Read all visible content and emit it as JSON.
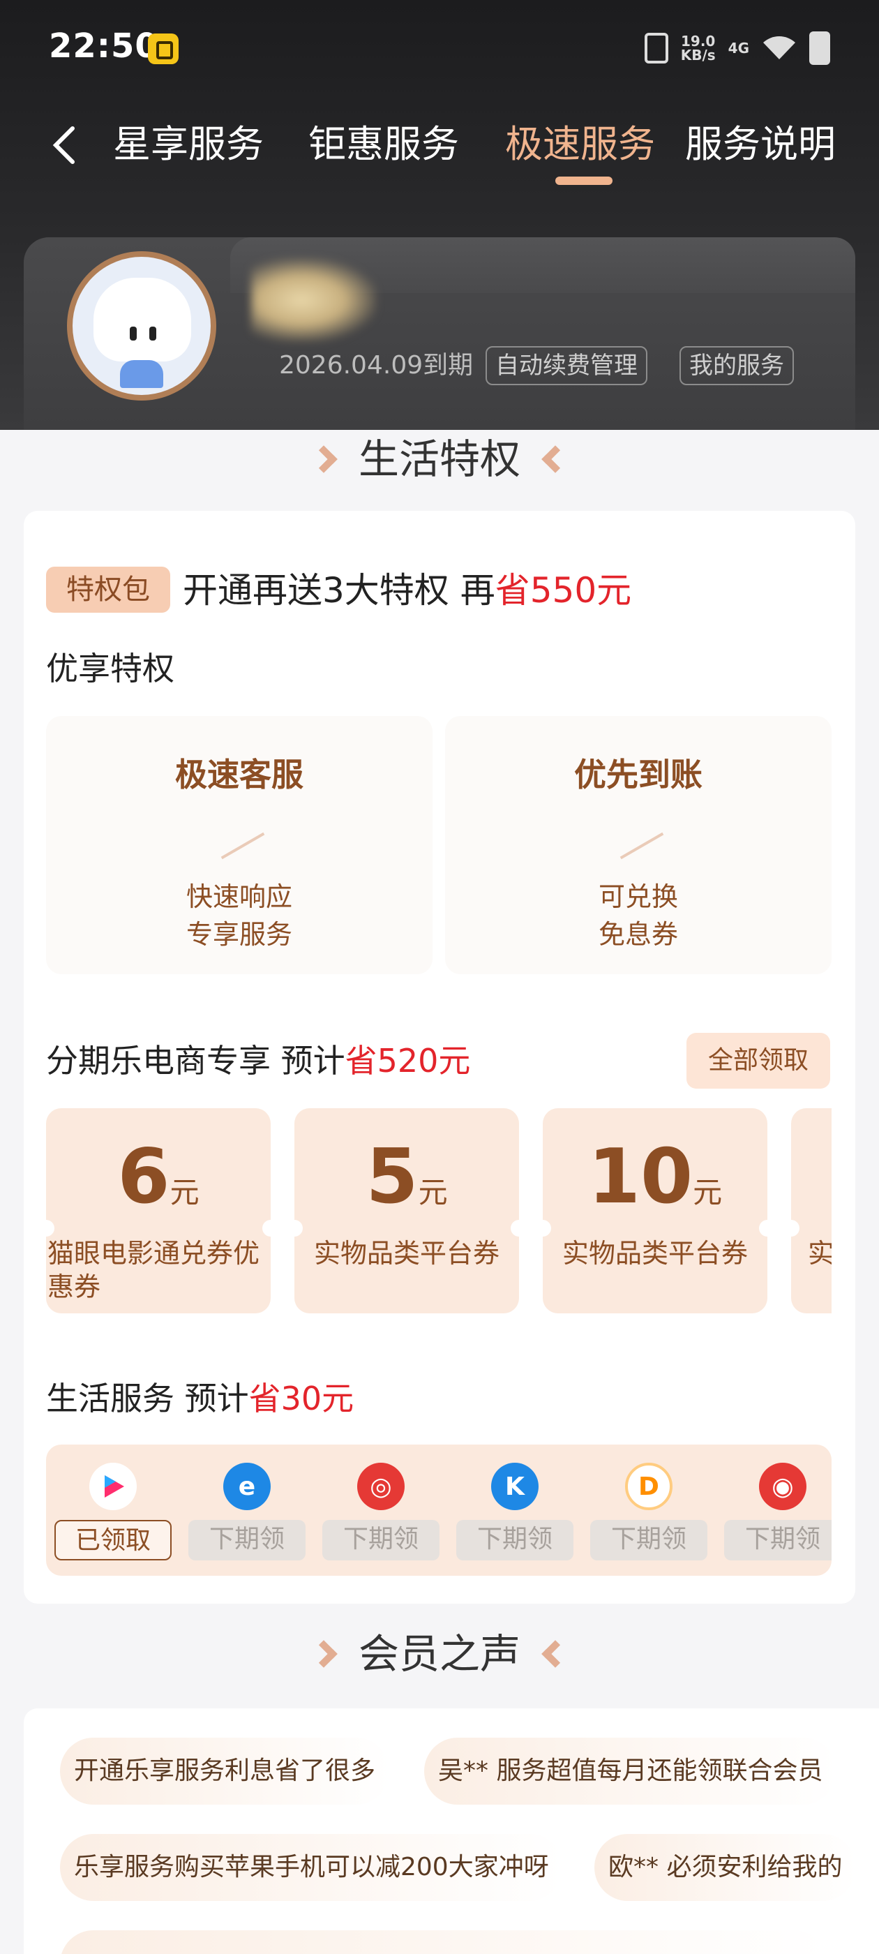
{
  "status_bar": {
    "time": "22:50",
    "net_speed_value": "19.0",
    "net_speed_unit": "KB/s",
    "network": "4G"
  },
  "nav": {
    "tabs": [
      {
        "label": "星享服务"
      },
      {
        "label": "钜惠服务"
      },
      {
        "label": "极速服务"
      },
      {
        "label": "服务说明"
      }
    ],
    "active_tab": "极速服务"
  },
  "member": {
    "expire_date": "2026.04.09到期",
    "auto_renew_label": "自动续费管理",
    "my_service_label": "我的服务"
  },
  "sections": {
    "life_privilege": "生活特权",
    "member_voice": "会员之声"
  },
  "privilege_pack": {
    "badge": "特权包",
    "headline_pre": "开通再送3大特权 再",
    "headline_save": "省550元"
  },
  "premium": {
    "title": "优享特权",
    "items": [
      {
        "name": "极速客服",
        "line1": "快速响应",
        "line2": "专享服务"
      },
      {
        "name": "优先到账",
        "line1": "可兑换",
        "line2": "免息券"
      }
    ]
  },
  "ecommerce": {
    "title_pre": "分期乐电商专享 预计",
    "title_save": "省520元",
    "collect_all": "全部领取",
    "coupons": [
      {
        "amount": "6",
        "unit": "元",
        "desc": "猫眼电影通兑券优惠券"
      },
      {
        "amount": "5",
        "unit": "元",
        "desc": "实物品类平台券"
      },
      {
        "amount": "10",
        "unit": "元",
        "desc": "实物品类平台券"
      },
      {
        "amount": "",
        "unit": "",
        "desc": "实"
      }
    ]
  },
  "life_service": {
    "title_pre": "生活服务 预计",
    "title_save": "省30元",
    "items": [
      {
        "icon": "video-app-icon",
        "button": "已领取",
        "color": "#ff2d6e"
      },
      {
        "icon": "e-app-icon",
        "button": "下期领",
        "color": "#1e88e5"
      },
      {
        "icon": "music-app-icon",
        "button": "下期领",
        "color": "#e53935"
      },
      {
        "icon": "k-app-icon",
        "button": "下期领",
        "color": "#1e88e5"
      },
      {
        "icon": "ride-app-icon",
        "button": "下期领",
        "color": "#ff8f00"
      },
      {
        "icon": "cat-app-icon",
        "button": "下期领",
        "color": "#e53935"
      }
    ]
  },
  "voices": [
    {
      "text": "开通乐享服务利息省了很多"
    },
    {
      "text": "吴**  服务超值每月还能领联合会员"
    },
    {
      "text": "乐享服务购买苹果手机可以减200大家冲呀"
    },
    {
      "text": "欧**  必须安利给我的"
    }
  ],
  "colors": {
    "accent": "#f0b48e",
    "brown": "#8c4e24",
    "save_red": "#e3242b"
  }
}
